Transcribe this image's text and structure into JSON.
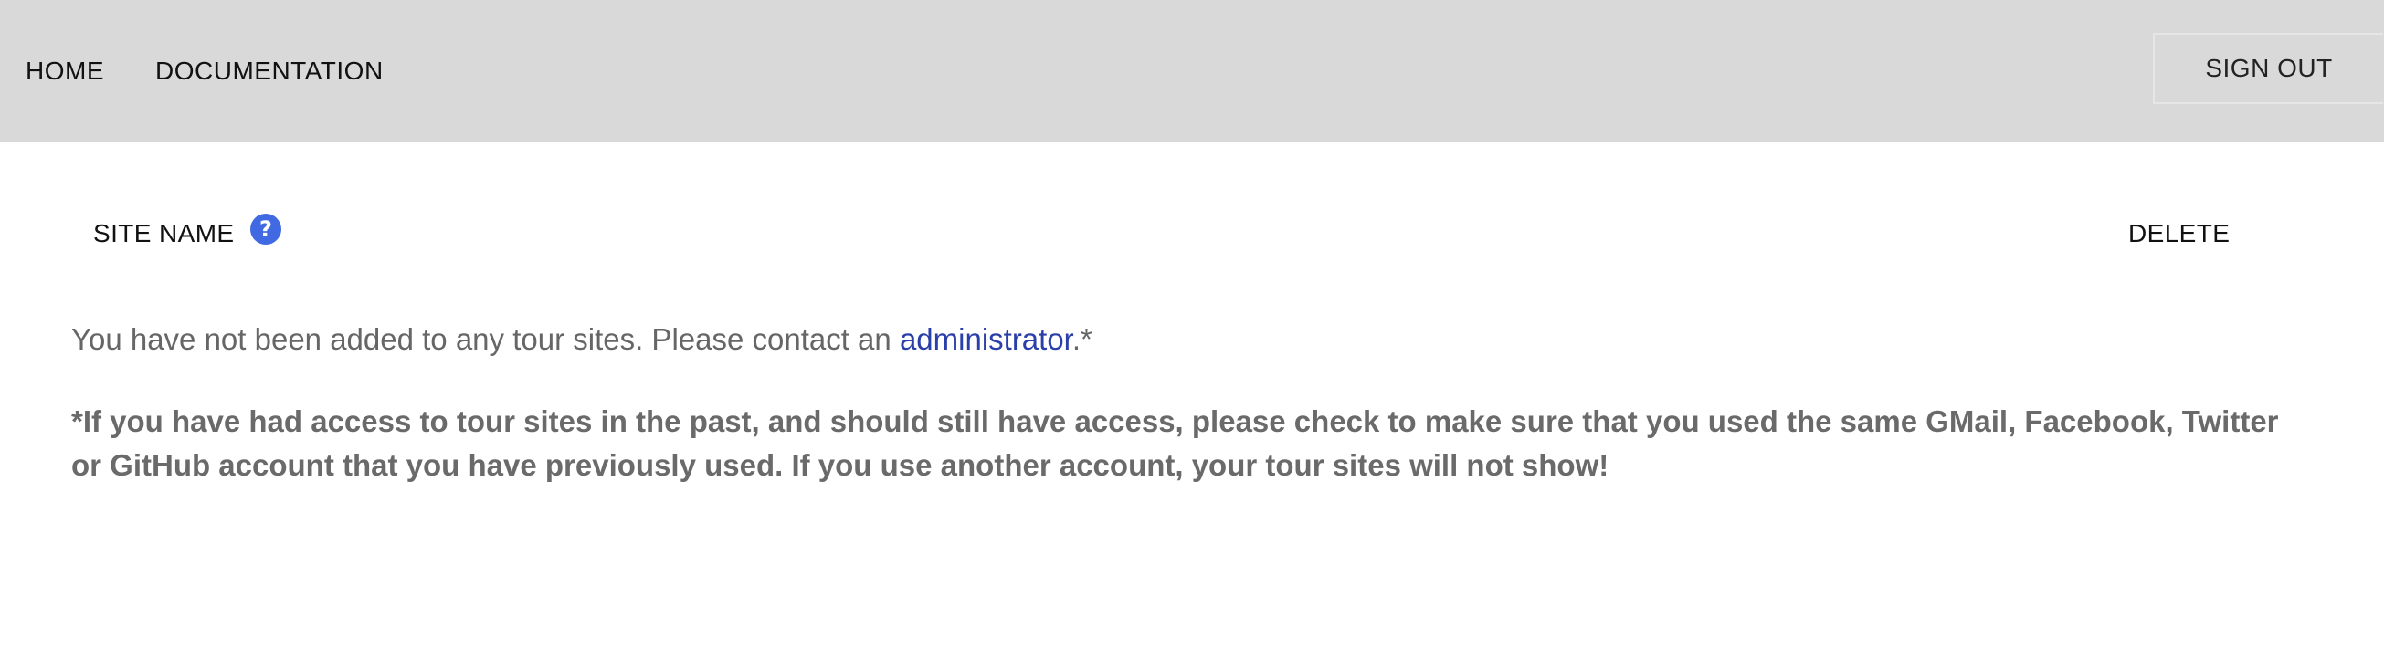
{
  "nav": {
    "home_label": "HOME",
    "docs_label": "DOCUMENTATION",
    "signout_label": "SIGN OUT"
  },
  "table": {
    "col_site_name": "SITE NAME",
    "help_icon": "question-circle-icon",
    "help_glyph": "?",
    "col_delete": "DELETE"
  },
  "message": {
    "prefix": "You have not been added to any tour sites. Please contact an ",
    "link_text": "administrator",
    "suffix": ".*"
  },
  "note": "*If you have had access to tour sites in the past, and should still have access, please check to make sure that you used the same GMail, Facebook, Twitter or GitHub account that you have previously used. If you use another account, your tour sites will not show!",
  "colors": {
    "navbar_bg": "#d9d9d9",
    "link": "#2a3fa8",
    "help_icon": "#4169e1",
    "muted_text": "#666666"
  }
}
